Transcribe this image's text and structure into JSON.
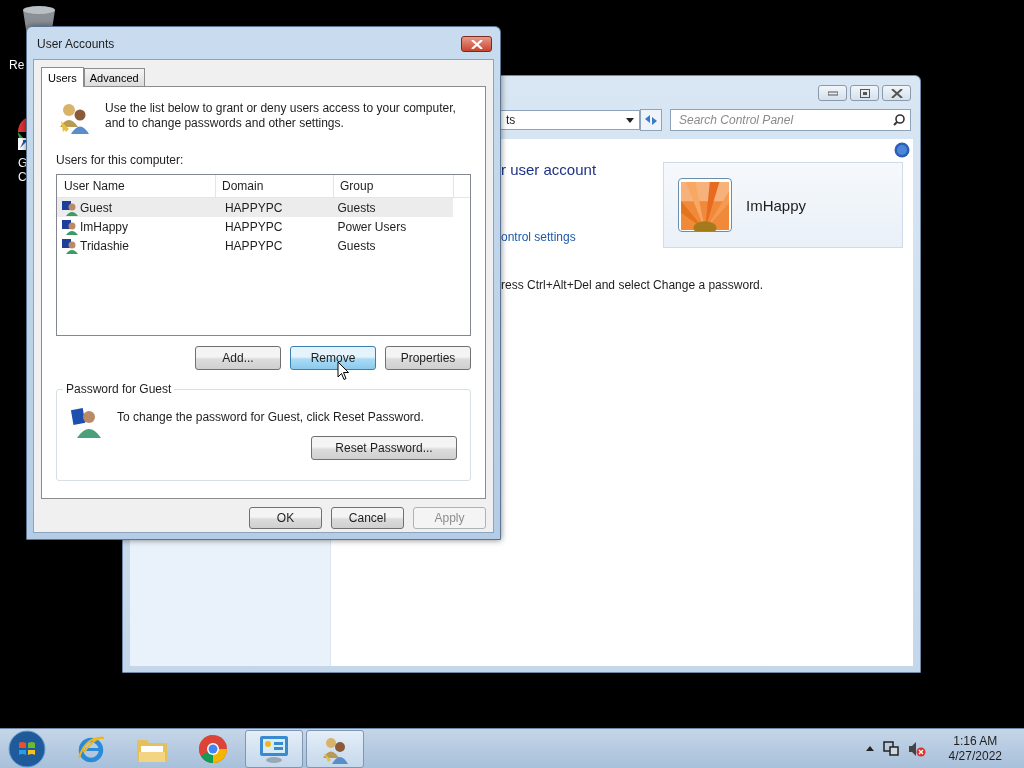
{
  "desktop_icons": [
    {
      "lines": [
        "Re"
      ]
    },
    {
      "lines": [
        "G",
        "C"
      ]
    }
  ],
  "control_panel": {
    "address_text": "ts",
    "search_placeholder": "Search Control Panel",
    "heading": "r user account",
    "link": "ontrol settings",
    "account": {
      "name": "ImHappy"
    },
    "note": "ress Ctrl+Alt+Del and select Change a password."
  },
  "dialog": {
    "title": "User Accounts",
    "tabs": [
      {
        "label": "Users",
        "selected": true
      },
      {
        "label": "Advanced",
        "selected": false
      }
    ],
    "intro": "Use the list below to grant or deny users access to your computer, and to change passwords and other settings.",
    "list_label": "Users for this computer:",
    "columns": [
      "User Name",
      "Domain",
      "Group"
    ],
    "rows": [
      {
        "name": "Guest",
        "domain": "HAPPYPC",
        "group": "Guests",
        "selected": true
      },
      {
        "name": "ImHappy",
        "domain": "HAPPYPC",
        "group": "Power Users",
        "selected": false
      },
      {
        "name": "Tridashie",
        "domain": "HAPPYPC",
        "group": "Guests",
        "selected": false
      }
    ],
    "list_buttons": [
      {
        "label": "Add...",
        "hot": false
      },
      {
        "label": "Remove",
        "hot": true
      },
      {
        "label": "Properties",
        "hot": false
      }
    ],
    "password_group": {
      "title": "Password for Guest",
      "text": "To change the password for Guest, click Reset Password.",
      "button": "Reset Password..."
    },
    "footer_buttons": [
      {
        "label": "OK",
        "disabled": false
      },
      {
        "label": "Cancel",
        "disabled": false
      },
      {
        "label": "Apply",
        "disabled": true
      }
    ]
  },
  "taskbar": {
    "items": [
      {
        "kind": "ie",
        "active": false
      },
      {
        "kind": "folder",
        "active": false
      },
      {
        "kind": "chrome",
        "active": false
      },
      {
        "kind": "control",
        "active": true
      },
      {
        "kind": "users",
        "active": true
      }
    ],
    "volume_muted": true,
    "time": "1:16 AM",
    "date": "4/27/2022"
  }
}
